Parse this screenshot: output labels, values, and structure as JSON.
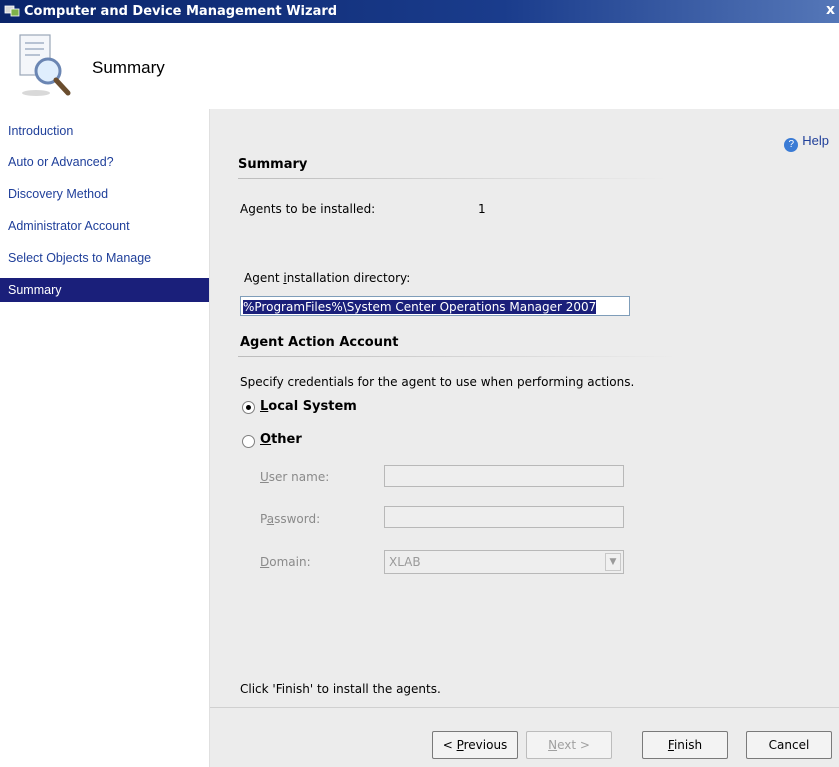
{
  "window": {
    "title": "Computer and Device Management Wizard",
    "close_label": "x"
  },
  "header": {
    "title": "Summary",
    "icon": "magnifier-document-icon"
  },
  "sidebar": {
    "items": [
      {
        "label": "Introduction",
        "active": false
      },
      {
        "label": "Auto or Advanced?",
        "active": false
      },
      {
        "label": "Discovery Method",
        "active": false
      },
      {
        "label": "Administrator Account",
        "active": false
      },
      {
        "label": "Select Objects to Manage",
        "active": false
      },
      {
        "label": "Summary",
        "active": true
      }
    ]
  },
  "content": {
    "help_label": "Help",
    "summary_title": "Summary",
    "agents_label": "Agents to be installed:",
    "agents_value": "1",
    "install_dir_label_pre": "Agent ",
    "install_dir_label_ul": "i",
    "install_dir_label_post": "nstallation directory:",
    "install_dir_value": "%ProgramFiles%\\System Center Operations Manager 2007",
    "action_account_title": "Agent Action Account",
    "credentials_text": "Specify credentials for the agent to use when performing actions.",
    "local_system": {
      "ul": "L",
      "rest": "ocal System",
      "selected": true
    },
    "other": {
      "ul": "O",
      "rest": "ther",
      "selected": false
    },
    "user_name": {
      "ul": "U",
      "rest": "ser name:",
      "value": ""
    },
    "password": {
      "pre": "P",
      "ul": "a",
      "rest": "ssword:",
      "value": ""
    },
    "domain": {
      "ul": "D",
      "rest": "omain:",
      "value": "XLAB"
    },
    "finish_hint": "Click 'Finish' to install the agents."
  },
  "buttons": {
    "previous": {
      "pre": "< ",
      "ul": "P",
      "rest": "revious",
      "enabled": true
    },
    "next": {
      "ul": "N",
      "rest": "ext >",
      "enabled": false
    },
    "finish": {
      "ul": "F",
      "rest": "inish",
      "enabled": true
    },
    "cancel": {
      "label": "Cancel",
      "enabled": true
    }
  }
}
